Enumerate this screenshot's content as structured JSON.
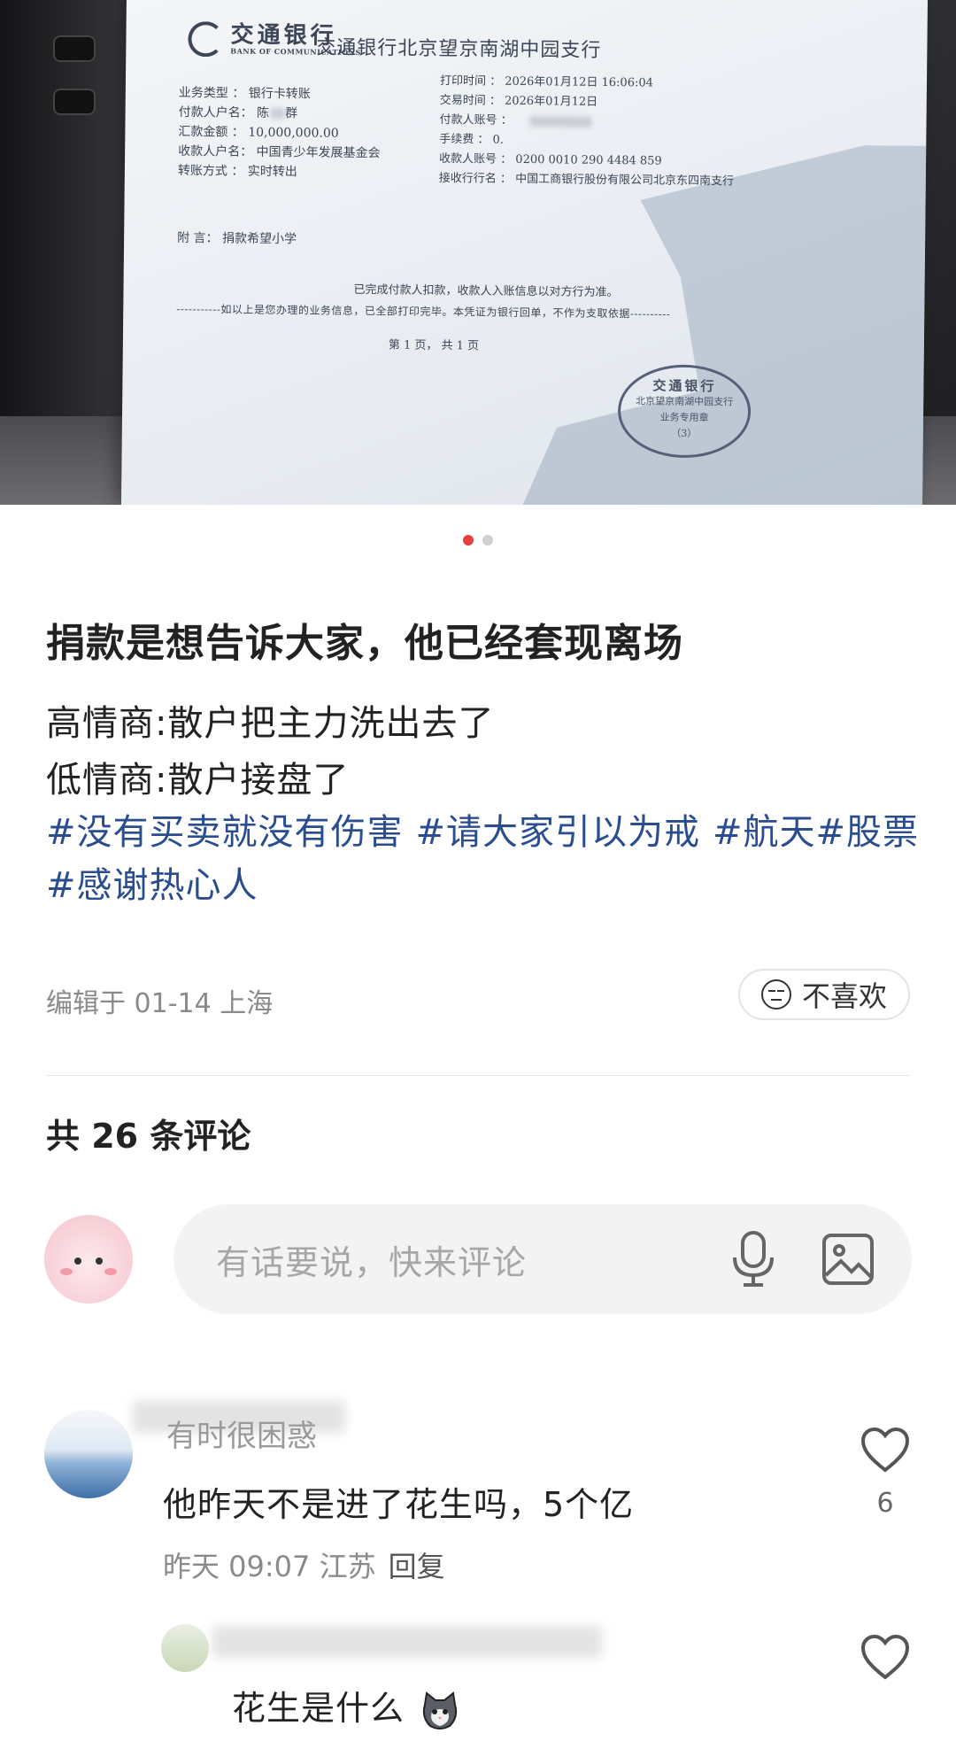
{
  "receipt": {
    "bank_name_cn": "交通银行",
    "bank_name_en": "BANK OF COMMUNICATIONS",
    "branch": "交通银行北京望京南湖中园支行",
    "left_rows": [
      "业务类型 ： 银行卡转账",
      "付款人户名： 陈",
      "汇款金额 ： 10,000,000.00",
      "收款人户名： 中国青少年发展基金会",
      "转账方式 ： 实时转出"
    ],
    "payer_name_suffix": "群",
    "right_rows": [
      "打印时间 ： 2026年01月12日 16:06:04",
      "交易时间 ： 2026年01月12日",
      "付款人账号 ：",
      "手续费 ： 0.",
      "收款人账号 ： 0200 0010 290  4484 859",
      "接收行行名 ： 中国工商银行股份有限公司北京东四南支行"
    ],
    "note": "附    言： 捐款希望小学",
    "completed": "已完成付款人扣款，收款人入账信息以对方行为准。",
    "info_line": "-----------如以上是您办理的业务信息，已全部打印完毕。本凭证为银行回单，不作为支取依据----------",
    "page": "第 1 页，  共 1 页",
    "stamp_title": "交通银行",
    "stamp_line1": "北京望京南湖中园支行",
    "stamp_line2": "业务专用章",
    "stamp_line3": "（3）"
  },
  "carousel": {
    "total": 2,
    "active": 1
  },
  "post": {
    "title": "捐款是想告诉大家，他已经套现离场",
    "line1": "高情商:散户把主力洗出去了",
    "line2": "低情商:散户接盘了",
    "tags": [
      "#没有买卖就没有伤害",
      "#请大家引以为戒",
      "#航天#股票#感谢热心人"
    ],
    "edited": "编辑于 01-14 上海",
    "dislike_label": "不喜欢"
  },
  "comments_header": "共 26 条评论",
  "input": {
    "placeholder": "有话要说，快来评论"
  },
  "comments": [
    {
      "name": "有时很困惑",
      "text": "他昨天不是进了花生吗，5个亿",
      "time": "昨天 09:07 江苏",
      "reply": "回复",
      "likes": "6"
    },
    {
      "text": "花生是什么",
      "emoji": "cat-face-emoji"
    }
  ],
  "colors": {
    "accent_red": "#e8403a",
    "tag_blue": "#2a4d8f",
    "meta_gray": "#8a8a8a"
  }
}
